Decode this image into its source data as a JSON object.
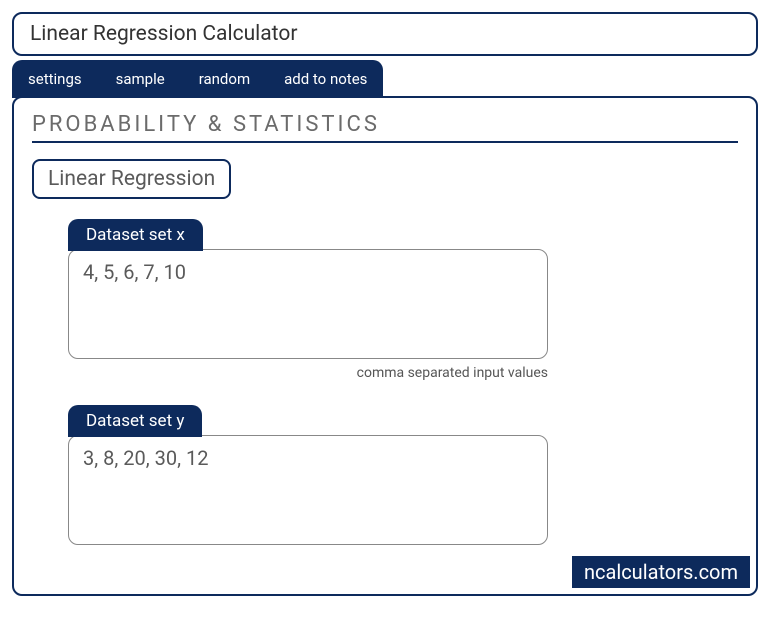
{
  "title": "Linear Regression Calculator",
  "tabs": {
    "settings": "settings",
    "sample": "sample",
    "random": "random",
    "add_to_notes": "add to notes"
  },
  "section_header": "PROBABILITY & STATISTICS",
  "calc_name": "Linear Regression",
  "dataset_x": {
    "label": "Dataset set x",
    "value": "4, 5, 6, 7, 10",
    "hint": "comma separated input values"
  },
  "dataset_y": {
    "label": "Dataset set y",
    "value": "3, 8, 20, 30, 12"
  },
  "watermark": "ncalculators.com"
}
